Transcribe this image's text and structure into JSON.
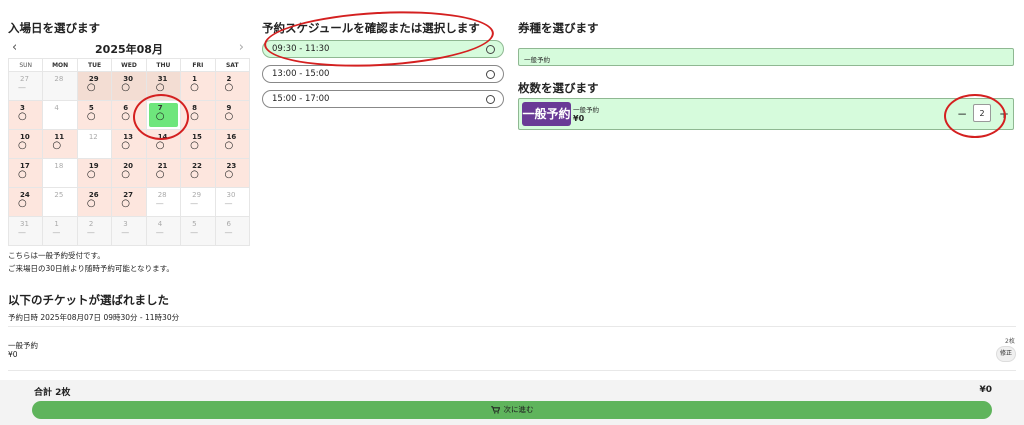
{
  "calendar": {
    "heading": "入場日を選びます",
    "prev_icon": "chevron-left-icon",
    "next_icon": "chevron-right-icon",
    "month": "2025年08月",
    "weekdays": [
      "SUN",
      "MON",
      "TUE",
      "WED",
      "THU",
      "FRI",
      "SAT"
    ],
    "weeks": [
      [
        {
          "d": "27",
          "m": "—",
          "s": "grey"
        },
        {
          "d": "28",
          "m": "",
          "s": "grey"
        },
        {
          "d": "29",
          "m": "○",
          "s": "tan"
        },
        {
          "d": "30",
          "m": "○",
          "s": "tan"
        },
        {
          "d": "31",
          "m": "○",
          "s": "tan"
        },
        {
          "d": "1",
          "m": "○",
          "s": "peach"
        },
        {
          "d": "2",
          "m": "○",
          "s": "peach"
        }
      ],
      [
        {
          "d": "3",
          "m": "○",
          "s": "peach"
        },
        {
          "d": "4",
          "m": "",
          "s": "white"
        },
        {
          "d": "5",
          "m": "○",
          "s": "peach"
        },
        {
          "d": "6",
          "m": "○",
          "s": "peach"
        },
        {
          "d": "7",
          "m": "○",
          "s": "sel"
        },
        {
          "d": "8",
          "m": "○",
          "s": "peach"
        },
        {
          "d": "9",
          "m": "○",
          "s": "peach"
        }
      ],
      [
        {
          "d": "10",
          "m": "○",
          "s": "peach"
        },
        {
          "d": "11",
          "m": "○",
          "s": "peach"
        },
        {
          "d": "12",
          "m": "",
          "s": "white"
        },
        {
          "d": "13",
          "m": "○",
          "s": "peach"
        },
        {
          "d": "14",
          "m": "○",
          "s": "peach"
        },
        {
          "d": "15",
          "m": "○",
          "s": "peach"
        },
        {
          "d": "16",
          "m": "○",
          "s": "peach"
        }
      ],
      [
        {
          "d": "17",
          "m": "○",
          "s": "peach"
        },
        {
          "d": "18",
          "m": "",
          "s": "white"
        },
        {
          "d": "19",
          "m": "○",
          "s": "peach"
        },
        {
          "d": "20",
          "m": "○",
          "s": "peach"
        },
        {
          "d": "21",
          "m": "○",
          "s": "peach"
        },
        {
          "d": "22",
          "m": "○",
          "s": "peach"
        },
        {
          "d": "23",
          "m": "○",
          "s": "peach"
        }
      ],
      [
        {
          "d": "24",
          "m": "○",
          "s": "peach"
        },
        {
          "d": "25",
          "m": "",
          "s": "white"
        },
        {
          "d": "26",
          "m": "○",
          "s": "peach"
        },
        {
          "d": "27",
          "m": "○",
          "s": "peach"
        },
        {
          "d": "28",
          "m": "—",
          "s": "white"
        },
        {
          "d": "29",
          "m": "—",
          "s": "white"
        },
        {
          "d": "30",
          "m": "—",
          "s": "white"
        }
      ],
      [
        {
          "d": "31",
          "m": "—",
          "s": "grey"
        },
        {
          "d": "1",
          "m": "—",
          "s": "grey"
        },
        {
          "d": "2",
          "m": "—",
          "s": "grey"
        },
        {
          "d": "3",
          "m": "—",
          "s": "grey"
        },
        {
          "d": "4",
          "m": "—",
          "s": "grey"
        },
        {
          "d": "5",
          "m": "—",
          "s": "grey"
        },
        {
          "d": "6",
          "m": "—",
          "s": "grey"
        }
      ]
    ],
    "note1": "こちらは一般予約受付です。",
    "note2": "ご来場日の30日前より随時予約可能となります。"
  },
  "schedule": {
    "heading": "予約スケジュールを確認または選択します",
    "slots": [
      {
        "label": "09:30 - 11:30",
        "active": true
      },
      {
        "label": "13:00 - 15:00",
        "active": false
      },
      {
        "label": "15:00 - 17:00",
        "active": false
      }
    ]
  },
  "ticket_type": {
    "heading": "券種を選びます",
    "selected": "一般予約"
  },
  "quantity": {
    "heading": "枚数を選びます",
    "badge": "一般予約",
    "name": "一般予約",
    "price": "¥0",
    "minus": "−",
    "value": "2",
    "plus": "+"
  },
  "summary": {
    "heading": "以下のチケットが選ばれました",
    "date_line": "予約日時 2025年08月07日 09時30分 - 11時30分",
    "item_name": "一般予約",
    "item_price": "¥0",
    "item_count": "2枚",
    "edit_label": "修正"
  },
  "footer": {
    "total_label": "合計 2枚",
    "total_amount": "¥0",
    "next_label": "次に進む",
    "next_icon": "cart-icon"
  },
  "colors": {
    "selected_green": "#6ee67c",
    "panel_green": "#d6fbdc",
    "button_green": "#5fb45c",
    "badge_purple": "#6a3a96",
    "annotation_red": "#d42020",
    "available_peach": "#fde6de"
  }
}
